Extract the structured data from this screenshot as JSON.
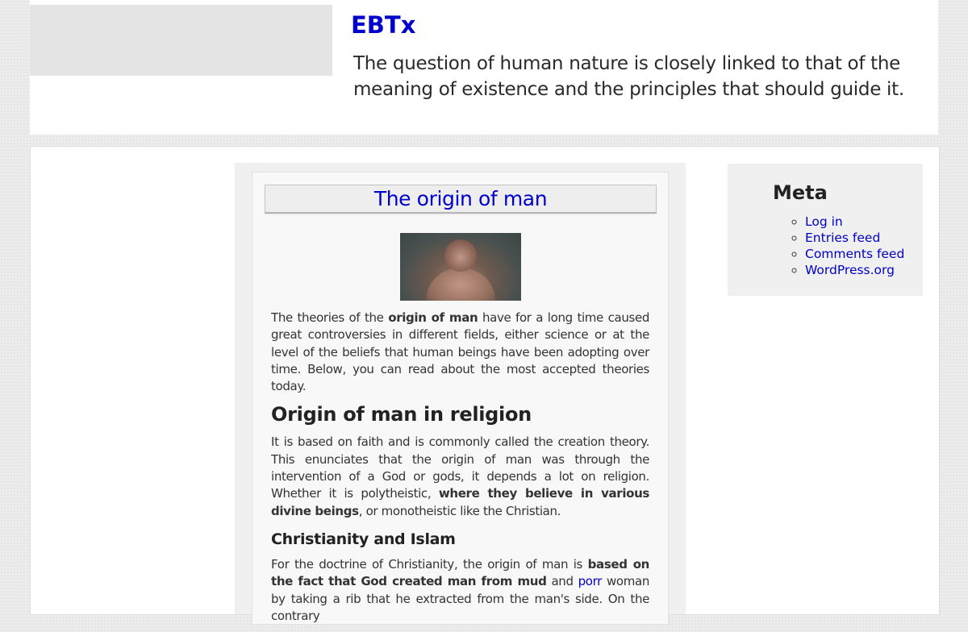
{
  "site": {
    "title": "EBTx",
    "tagline": "The question of human nature is closely linked to that of the meaning of existence and the principles that should guide it."
  },
  "article": {
    "title": "The origin of man",
    "image_alt": "ape-like figure",
    "intro": {
      "t1": "The theories of the ",
      "b1": "origin of man",
      "t2": " have for a long time caused great controversies in different fields, either science or at the level of the beliefs that human beings have been adopting over time. Below, you can read about the most accepted theories today."
    },
    "section1": {
      "heading": "Origin of man in religion",
      "t1": "It is based on faith and is commonly called the creation theory. This enunciates that the origin of man was through the intervention of a God or gods, it depends a lot on religion. Whether it is polytheistic, ",
      "b1": "where they believe in various divine beings",
      "t2": ", or monotheistic like the Christian."
    },
    "section2": {
      "heading": "Christianity and Islam",
      "t1": "For the doctrine of Christianity, the origin of man is ",
      "b1": "based on the fact that God created man from mud",
      "t2": " and ",
      "link": "porr",
      "t3": " woman by taking a rib that he extracted from the man's side. On the contrary"
    }
  },
  "sidebar": {
    "meta": {
      "title": "Meta",
      "links": [
        "Log in",
        "Entries feed",
        "Comments feed",
        "WordPress.org"
      ]
    }
  },
  "colors": {
    "link": "#0000cc",
    "text": "#333333",
    "background": "#ececec"
  }
}
